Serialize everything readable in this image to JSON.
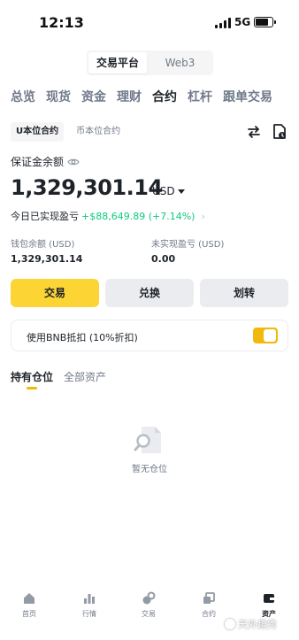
{
  "status_bar": {
    "time": "12:13",
    "network": "5G"
  },
  "platform_switch": {
    "active": "交易平台",
    "inactive": "Web3"
  },
  "nav_tabs": [
    "总览",
    "现货",
    "资金",
    "理财",
    "合约",
    "杠杆",
    "跟单交易"
  ],
  "nav_active": "合约",
  "sub_tabs": [
    "U本位合约",
    "币本位合约"
  ],
  "balance": {
    "label": "保证金余额",
    "value": "1,329,301.14",
    "currency": "USD"
  },
  "pnl": {
    "label": "今日已实现盈亏",
    "value": "+$88,649.89 (+7.14%)",
    "color": "#0ecb81"
  },
  "wallet": {
    "label": "钱包余额 (USD)",
    "value": "1,329,301.14"
  },
  "unrealized": {
    "label": "未实现盈亏 (USD)",
    "value": "0.00"
  },
  "actions": {
    "trade": "交易",
    "exchange": "兑换",
    "transfer": "划转"
  },
  "bnb_discount": {
    "label": "使用BNB抵扣 (10%折扣)",
    "enabled": true
  },
  "position_tabs": {
    "holdings": "持有仓位",
    "all_assets": "全部资产"
  },
  "empty_state": {
    "text": "暂无仓位"
  },
  "bottom_nav": {
    "home": "首页",
    "market": "行情",
    "trade": "交易",
    "futures": "合约",
    "assets": "资产"
  },
  "watermark": {
    "text": "天外趣秀"
  },
  "colors": {
    "accent": "#fcd535",
    "toggle": "#f0b90b",
    "positive": "#0ecb81"
  }
}
